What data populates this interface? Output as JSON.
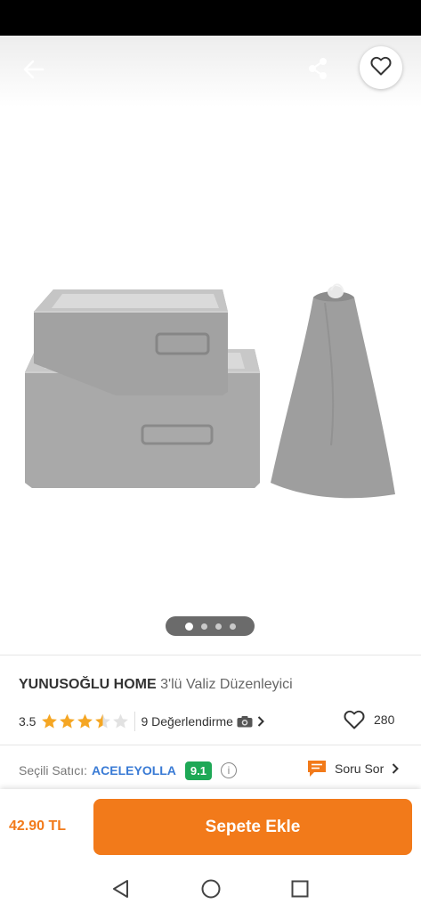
{
  "product": {
    "brand": "YUNUSOĞLU HOME",
    "name": "3'lü Valiz Düzenleyici",
    "rating": "3.5",
    "rating_value": 3.5,
    "review_count_text": "9 Değerlendirme",
    "favorite_count": "280"
  },
  "gallery": {
    "image_count": 4,
    "active_index": 0
  },
  "seller": {
    "label": "Seçili Satıcı:",
    "name": "ACELEYOLLA",
    "score": "9.1",
    "question_label": "Soru Sor"
  },
  "purchase": {
    "price": "42.90 TL",
    "button_label": "Sepete Ekle"
  },
  "icons": [
    "back-arrow-icon",
    "share-icon",
    "heart-icon",
    "star-icon",
    "camera-icon",
    "chevron-right-icon",
    "info-icon",
    "chat-icon",
    "nav-back-icon",
    "nav-home-icon",
    "nav-recents-icon"
  ],
  "colors": {
    "accent": "#f27a1a",
    "star": "#f5a623",
    "seller_link": "#3a7bd5",
    "seller_score": "#1ea856"
  }
}
